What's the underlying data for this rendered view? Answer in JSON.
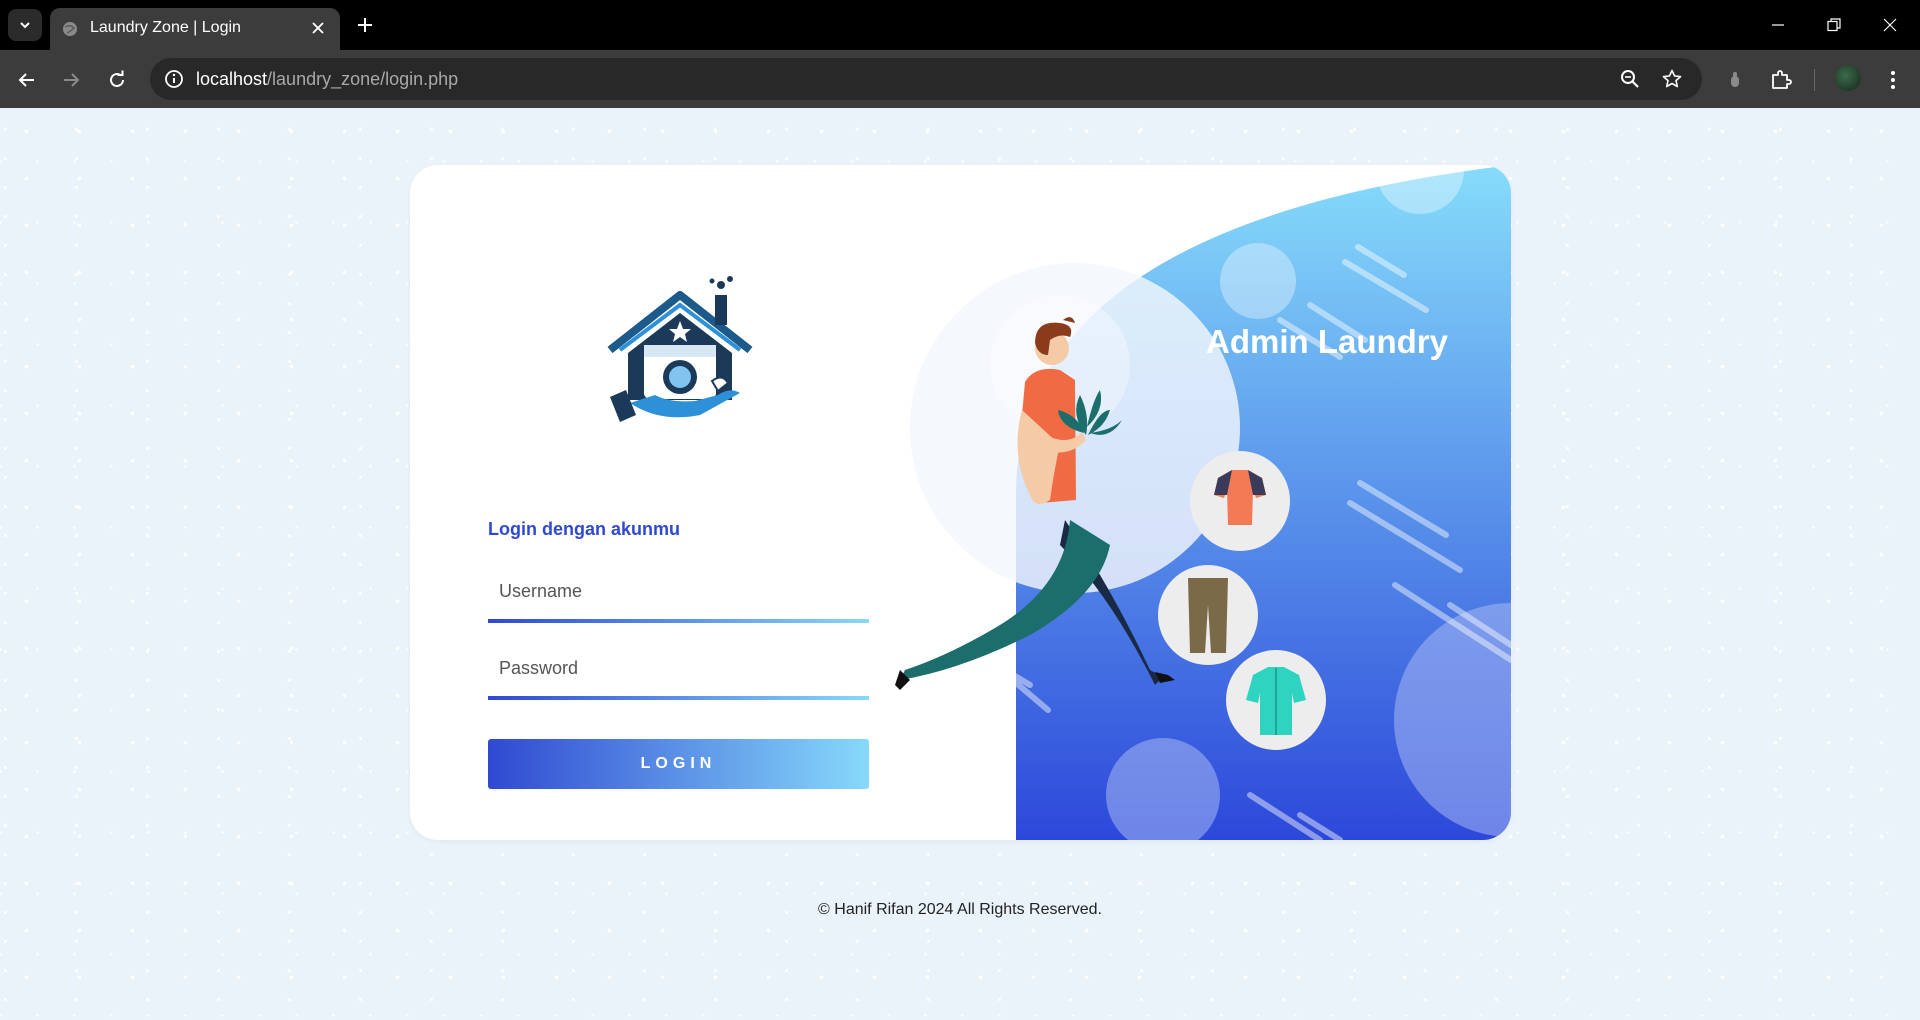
{
  "browser": {
    "tab_title": "Laundry Zone | Login",
    "url_host": "localhost",
    "url_path": "/laundry_zone/login.php",
    "icons": [
      "tab-search-icon",
      "globe-icon",
      "close-icon",
      "plus-icon",
      "minimize-icon",
      "restore-icon",
      "back-icon",
      "forward-icon",
      "reload-icon",
      "site-info-icon",
      "zoom-icon",
      "star-icon",
      "extension-icon",
      "puzzle-icon",
      "menu-icon"
    ]
  },
  "login": {
    "heading": "Login dengan akunmu",
    "username_placeholder": "Username",
    "password_placeholder": "Password",
    "button_label": "LOGIN"
  },
  "hero": {
    "title": "Admin Laundry"
  },
  "footer": {
    "text": "© Hanif Rifan 2024 All Rights Reserved."
  },
  "colors": {
    "accent": "#2f49d1",
    "accent_light": "#87d9fb",
    "page_bg": "#eaf3f9"
  }
}
